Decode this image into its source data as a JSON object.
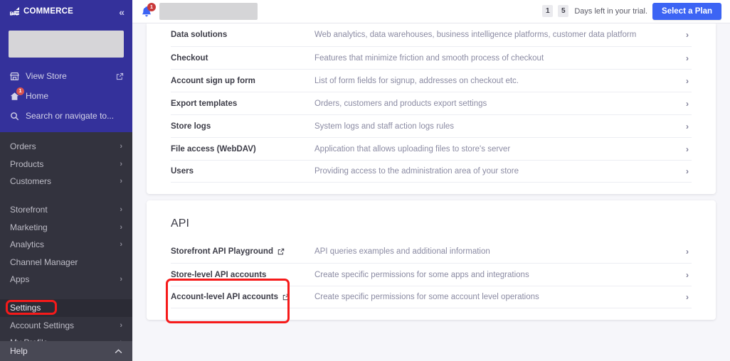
{
  "sidebar": {
    "brand": {
      "mark": "bigcommerce-logo",
      "text": "COMMERCE",
      "big": "BIG"
    },
    "collapse_label": "«",
    "store_name_redacted": "",
    "quick_links": [
      {
        "label": "View Store",
        "icon": "store-icon",
        "trailing_icon": "external-link-icon"
      },
      {
        "label": "Home",
        "icon": "home-icon",
        "badge": "1"
      },
      {
        "label": "Search or navigate to...",
        "icon": "search-icon"
      }
    ],
    "nav_groups": [
      {
        "items": [
          {
            "label": "Orders",
            "chevron": "›"
          },
          {
            "label": "Products",
            "chevron": "›"
          },
          {
            "label": "Customers",
            "chevron": "›"
          }
        ]
      },
      {
        "items": [
          {
            "label": "Storefront",
            "chevron": "›"
          },
          {
            "label": "Marketing",
            "chevron": "›"
          },
          {
            "label": "Analytics",
            "chevron": "›"
          },
          {
            "label": "Channel Manager",
            "chevron": ""
          },
          {
            "label": "Apps",
            "chevron": "›"
          }
        ]
      },
      {
        "items": [
          {
            "label": "Settings",
            "chevron": "",
            "active": true
          },
          {
            "label": "Account Settings",
            "chevron": "›"
          },
          {
            "label": "My Profile",
            "chevron": "›"
          }
        ]
      }
    ],
    "help": {
      "label": "Help",
      "chevron": "⌃"
    }
  },
  "topbar": {
    "notifications_icon": "bell-icon",
    "notifications_count": "1",
    "store_name_redacted": "",
    "trial_days_digit_1": "1",
    "trial_days_digit_2": "5",
    "trial_text": "Days left in your trial.",
    "select_plan_label": "Select a Plan"
  },
  "settings_card": {
    "rows": [
      {
        "label": "Data solutions",
        "desc": "Web analytics, data warehouses, business intelligence platforms, customer data platform",
        "chevron": "›"
      },
      {
        "label": "Checkout",
        "desc": "Features that minimize friction and smooth process of checkout",
        "chevron": "›"
      },
      {
        "label": "Account sign up form",
        "desc": "List of form fields for signup, addresses on checkout etc.",
        "chevron": "›"
      },
      {
        "label": "Export templates",
        "desc": "Orders, customers and products export settings",
        "chevron": "›"
      },
      {
        "label": "Store logs",
        "desc": "System logs and staff action logs rules",
        "chevron": "›"
      },
      {
        "label": "File access (WebDAV)",
        "desc": "Application that allows uploading files to store's server",
        "chevron": "›"
      },
      {
        "label": "Users",
        "desc": "Providing access to the administration area of your store",
        "chevron": "›"
      }
    ]
  },
  "api_card": {
    "title": "API",
    "rows": [
      {
        "label": "Storefront API Playground",
        "external": true,
        "desc": "API queries examples and additional information",
        "chevron": "›"
      },
      {
        "label": "Store-level API accounts",
        "external": false,
        "desc": "Create specific permissions for some apps and integrations",
        "chevron": "›"
      },
      {
        "label": "Account-level API accounts",
        "external": true,
        "desc": "Create specific permissions for some account level operations",
        "chevron": "›"
      }
    ]
  },
  "annotations": {
    "settings_highlight": "settings-nav-highlight",
    "api_highlight": "api-accounts-highlight",
    "color": "#f61a1a"
  }
}
